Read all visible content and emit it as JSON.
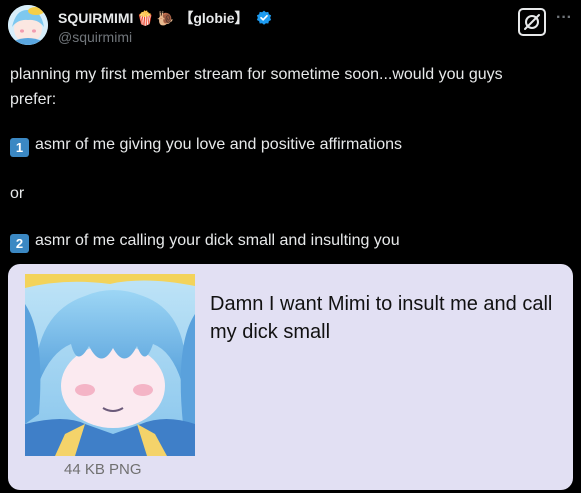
{
  "author": {
    "display_name": "SQUIRMIMI",
    "emoji_1": "🍿",
    "emoji_2": "🐌",
    "tag": "【globie】",
    "handle": "@squirmimi",
    "verified_icon": "verified-badge-icon",
    "verified_color": "#1d9bf0"
  },
  "actions": {
    "grok_icon": "grok-icon",
    "more_icon": "more-options-icon",
    "more_label": "···"
  },
  "tweet": {
    "line_1": "planning my first member stream for sometime soon...would you guys",
    "line_2": "prefer:",
    "option_1_key": "1",
    "option_1": "asmr of me giving you love and positive affirmations",
    "or": "or",
    "option_2_key": "2",
    "option_2": "asmr of me calling your dick small and insulting you"
  },
  "attachment": {
    "image_icon": "anime-character-image",
    "caption": "44 KB PNG",
    "text": "Damn I want Mimi to insult me and call my dick small"
  },
  "colors": {
    "background": "#000000",
    "text": "#e7e9ea",
    "secondary_text": "#71767b",
    "keycap": "#3b88c3",
    "card_background": "#e2e0f3"
  }
}
